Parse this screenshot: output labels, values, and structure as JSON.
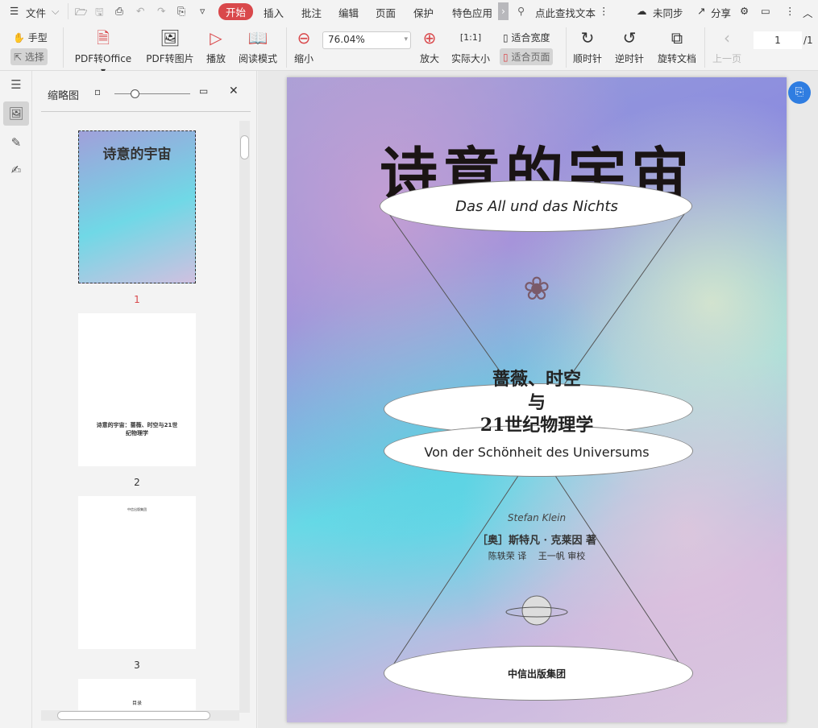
{
  "menubar": {
    "file": "文件",
    "tabs": [
      "开始",
      "插入",
      "批注",
      "编辑",
      "页面",
      "保护",
      "特色应用"
    ],
    "search_placeholder": "点此查找文本",
    "sync": "未同步",
    "share": "分享"
  },
  "toolbar": {
    "hand": "手型",
    "select": "选择",
    "pdf_to_office": "PDF转Office",
    "pdf_to_image": "PDF转图片",
    "play": "播放",
    "read_mode": "阅读模式",
    "zoom_out": "缩小",
    "zoom_value": "76.04%",
    "zoom_in": "放大",
    "actual_size": "实际大小",
    "fit_width": "适合宽度",
    "fit_page": "适合页面",
    "clockwise": "顺时针",
    "counterclockwise": "逆时针",
    "rotate_doc": "旋转文档",
    "prev_page": "上一页",
    "page_current": "1",
    "page_total": "/1"
  },
  "thumbs": {
    "title": "缩略图",
    "pages": [
      {
        "num": "1",
        "text": "诗意的宇宙"
      },
      {
        "num": "2",
        "text": "诗意的宇宙：蔷薇、时空与21世纪物理学"
      },
      {
        "num": "3",
        "text": "中信出版集团"
      },
      {
        "num": "",
        "text": "目录"
      }
    ]
  },
  "cover": {
    "title": "诗意的宇宙",
    "subtitle_de": "Das All und das Nichts",
    "subtitle_cn_1": "蔷薇、时空",
    "subtitle_cn_2": "与",
    "subtitle_cn_3": "21世纪物理学",
    "subtitle_de2": "Von der Schönheit des Universums",
    "author_en": "Stefan Klein",
    "author_cn": "［奥］斯特凡 · 克莱因 著",
    "translators": "陈轶荣 译　 王一帆 审校",
    "publisher": "中信出版集团"
  }
}
